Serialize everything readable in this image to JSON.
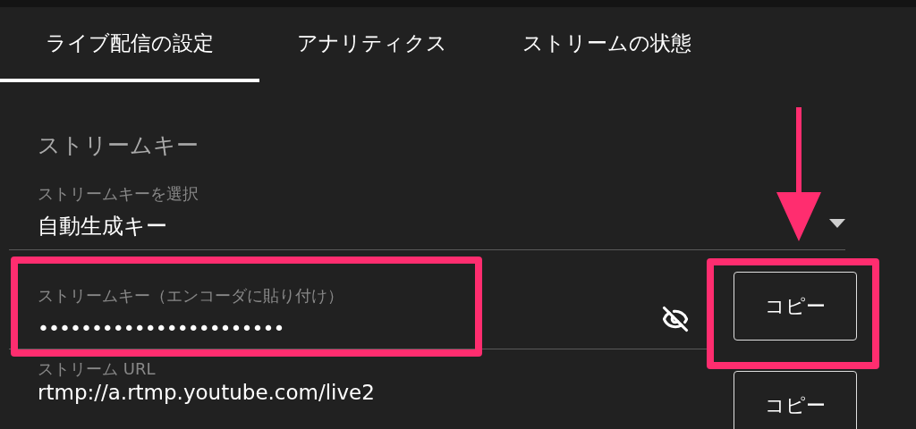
{
  "tabs": [
    {
      "label": "ライブ配信の設定",
      "selected": true
    },
    {
      "label": "アナリティクス",
      "selected": false
    },
    {
      "label": "ストリームの状態",
      "selected": false
    }
  ],
  "section_title": "ストリームキー",
  "key_select": {
    "label": "ストリームキーを選択",
    "value": "自動生成キー"
  },
  "fields": [
    {
      "label": "ストリームキー（エンコーダに貼り付け）",
      "value": "•••••••••••••••••••••••",
      "masked": true,
      "button": "コピー"
    },
    {
      "label": "ストリーム URL",
      "value": "rtmp://a.rtmp.youtube.com/live2",
      "masked": false,
      "button": "コピー"
    }
  ],
  "annotation": {
    "color": "#ff2d6f",
    "arrow": true,
    "field_frame": true,
    "button_frame": true
  }
}
